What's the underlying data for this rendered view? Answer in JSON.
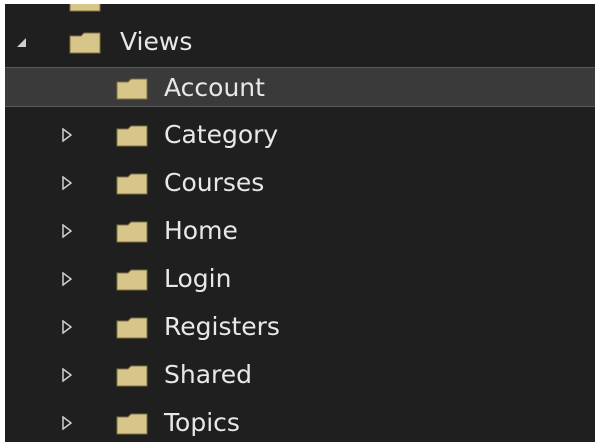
{
  "explorer": {
    "parent": {
      "label": "Views",
      "icon": "folder-icon",
      "expander": "expanded-triangle-icon"
    },
    "items": [
      {
        "label": "Account",
        "selected": true,
        "expandable": false
      },
      {
        "label": "Category",
        "selected": false,
        "expandable": true
      },
      {
        "label": "Courses",
        "selected": false,
        "expandable": true
      },
      {
        "label": "Home",
        "selected": false,
        "expandable": true
      },
      {
        "label": "Login",
        "selected": false,
        "expandable": true
      },
      {
        "label": "Registers",
        "selected": false,
        "expandable": true
      },
      {
        "label": "Shared",
        "selected": false,
        "expandable": true
      },
      {
        "label": "Topics",
        "selected": false,
        "expandable": true
      }
    ]
  },
  "colors": {
    "background": "#1f1f1f",
    "selected_row": "#3a3a3a",
    "text": "#e8e8e8",
    "folder": "#d8c58a",
    "arrow": "#cfcfcf"
  }
}
